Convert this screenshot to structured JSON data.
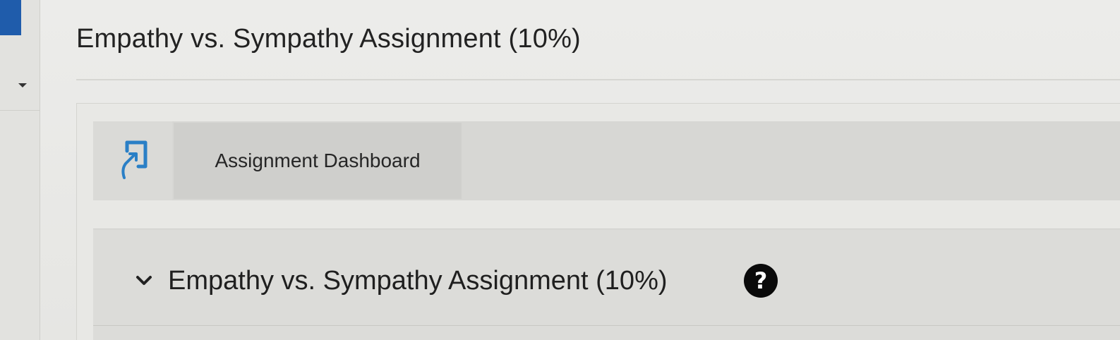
{
  "page": {
    "title": "Empathy vs. Sympathy Assignment (10%)"
  },
  "toolbar": {
    "launch_icon": "external-launch-icon",
    "dashboard_label": "Assignment Dashboard"
  },
  "section": {
    "chevron_icon": "chevron-down-icon",
    "title": "Empathy vs. Sympathy Assignment (10%)",
    "help_icon": "question-mark-icon",
    "help_glyph": "?"
  },
  "colors": {
    "accent_blue": "#1f5cab",
    "help_icon_bg": "#0a0a0a"
  }
}
